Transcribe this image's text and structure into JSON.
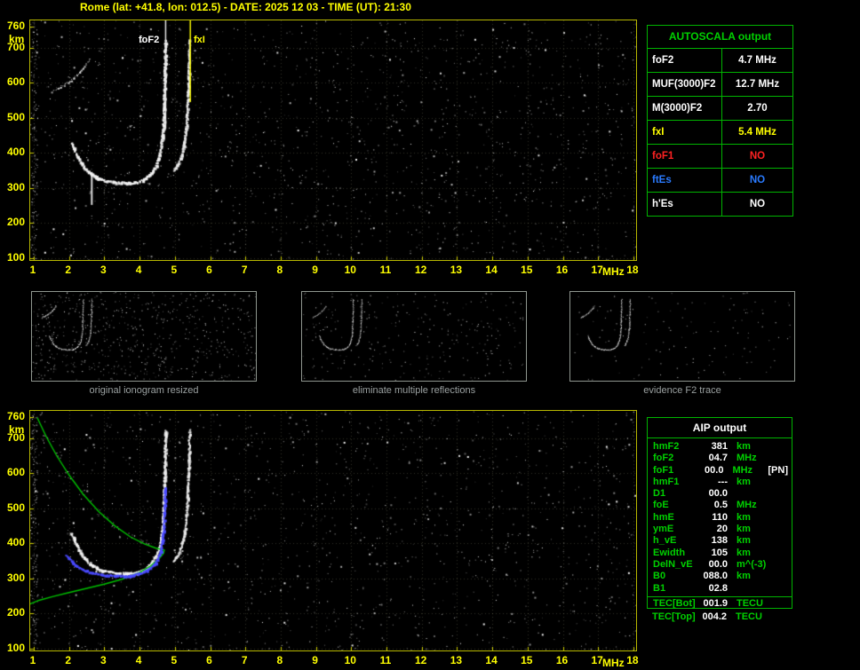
{
  "header": {
    "title": "Rome (lat: +41.8, lon: 012.5) - DATE: 2025 12 03 - TIME (UT): 21:30"
  },
  "axes": {
    "y_unit": "km",
    "x_unit": "MHz",
    "y_ticks": [
      760,
      700,
      600,
      500,
      400,
      300,
      200,
      100
    ],
    "x_ticks": [
      1,
      2,
      3,
      4,
      5,
      6,
      7,
      8,
      9,
      10,
      11,
      12,
      13,
      14,
      15,
      16,
      17,
      18
    ]
  },
  "top_plot": {
    "foF2_label": "foF2",
    "fxI_label": "fxI"
  },
  "autoscala_table": {
    "title": "AUTOSCALA output",
    "rows": [
      {
        "label": "foF2",
        "value": "4.7 MHz",
        "color": "#ffffff"
      },
      {
        "label": "MUF(3000)F2",
        "value": "12.7 MHz",
        "color": "#ffffff"
      },
      {
        "label": "M(3000)F2",
        "value": "2.70",
        "color": "#ffffff"
      },
      {
        "label": "fxI",
        "value": "5.4 MHz",
        "color": "#ffff00"
      },
      {
        "label": "foF1",
        "value": "NO",
        "color": "#ff2222"
      },
      {
        "label": "ftEs",
        "value": "NO",
        "color": "#2a7bff"
      },
      {
        "label": "h'Es",
        "value": "NO",
        "color": "#ffffff"
      }
    ]
  },
  "panels": [
    {
      "caption": "original ionogram resized"
    },
    {
      "caption": "eliminate multiple reflections"
    },
    {
      "caption": "evidence F2 trace"
    }
  ],
  "aip_table": {
    "title": "AIP output",
    "rows": [
      {
        "label": "hmF2",
        "value": "381",
        "unit": "km",
        "extra": ""
      },
      {
        "label": "foF2",
        "value": "04.7",
        "unit": "MHz",
        "extra": ""
      },
      {
        "label": "foF1",
        "value": "00.0",
        "unit": "MHz",
        "extra": "[PN]"
      },
      {
        "label": "hmF1",
        "value": "---",
        "unit": "km",
        "extra": ""
      },
      {
        "label": "D1",
        "value": "00.0",
        "unit": "",
        "extra": ""
      },
      {
        "label": "foE",
        "value": "0.5",
        "unit": "MHz",
        "extra": ""
      },
      {
        "label": "hmE",
        "value": "110",
        "unit": "km",
        "extra": ""
      },
      {
        "label": "ymE",
        "value": "20",
        "unit": "km",
        "extra": ""
      },
      {
        "label": "h_vE",
        "value": "138",
        "unit": "km",
        "extra": ""
      },
      {
        "label": "Ewidth",
        "value": "105",
        "unit": "km",
        "extra": ""
      },
      {
        "label": "DelN_vE",
        "value": "00.0",
        "unit": "m^(-3)",
        "extra": ""
      },
      {
        "label": "B0",
        "value": "088.0",
        "unit": "km",
        "extra": ""
      },
      {
        "label": "B1",
        "value": "02.8",
        "unit": "",
        "extra": ""
      }
    ],
    "tec_rows": [
      {
        "label": "TEC[Bot]",
        "value": "001.9",
        "unit": "TECU"
      },
      {
        "label": "TEC[Top]",
        "value": "004.2",
        "unit": "TECU"
      }
    ]
  },
  "chart_data": {
    "type": "scatter",
    "title": "Ionogram - Rome 2025-12-03 21:30 UT",
    "xlabel": "MHz",
    "ylabel": "km",
    "xlim": [
      1,
      18
    ],
    "ylim": [
      100,
      760
    ],
    "foF2_mhz": 4.7,
    "fxI_mhz": 5.4,
    "MUF3000F2_mhz": 12.7,
    "M3000F2": 2.7,
    "hmF2_km": 381,
    "traces": {
      "f2_ordinary": [
        [
          2.05,
          430
        ],
        [
          2.2,
          395
        ],
        [
          2.4,
          362
        ],
        [
          2.6,
          342
        ],
        [
          2.8,
          330
        ],
        [
          3.0,
          323
        ],
        [
          3.3,
          318
        ],
        [
          3.6,
          316
        ],
        [
          3.9,
          318
        ],
        [
          4.1,
          326
        ],
        [
          4.3,
          342
        ],
        [
          4.45,
          365
        ],
        [
          4.55,
          395
        ],
        [
          4.62,
          435
        ],
        [
          4.66,
          485
        ],
        [
          4.68,
          545
        ],
        [
          4.7,
          625
        ],
        [
          4.72,
          725
        ]
      ],
      "f2_extraordinary": [
        [
          4.95,
          352
        ],
        [
          5.05,
          365
        ],
        [
          5.15,
          388
        ],
        [
          5.24,
          422
        ],
        [
          5.3,
          470
        ],
        [
          5.34,
          535
        ],
        [
          5.37,
          615
        ],
        [
          5.4,
          725
        ]
      ],
      "upper_arc": [
        [
          1.5,
          575
        ],
        [
          1.7,
          585
        ],
        [
          1.9,
          598
        ],
        [
          2.1,
          613
        ],
        [
          2.3,
          632
        ],
        [
          2.45,
          650
        ],
        [
          2.58,
          670
        ]
      ],
      "profile_green": [
        [
          1.1,
          758
        ],
        [
          1.35,
          705
        ],
        [
          1.65,
          650
        ],
        [
          2.0,
          595
        ],
        [
          2.4,
          540
        ],
        [
          2.85,
          490
        ],
        [
          3.3,
          450
        ],
        [
          3.75,
          418
        ],
        [
          4.15,
          398
        ],
        [
          4.45,
          387
        ],
        [
          4.65,
          382
        ],
        [
          4.7,
          381
        ],
        [
          4.68,
          372
        ],
        [
          4.55,
          356
        ],
        [
          4.3,
          335
        ],
        [
          3.95,
          315
        ],
        [
          3.5,
          298
        ],
        [
          3.0,
          284
        ],
        [
          2.5,
          272
        ],
        [
          2.0,
          260
        ],
        [
          1.55,
          249
        ],
        [
          1.15,
          238
        ],
        [
          0.85,
          226
        ],
        [
          0.65,
          212
        ],
        [
          0.52,
          195
        ],
        [
          0.46,
          175
        ],
        [
          0.43,
          150
        ],
        [
          0.42,
          125
        ],
        [
          0.42,
          105
        ]
      ],
      "fitted_blue": [
        [
          1.9,
          368
        ],
        [
          2.1,
          345
        ],
        [
          2.35,
          328
        ],
        [
          2.65,
          317
        ],
        [
          3.0,
          311
        ],
        [
          3.35,
          309
        ],
        [
          3.7,
          310
        ],
        [
          4.0,
          316
        ],
        [
          4.25,
          328
        ],
        [
          4.45,
          348
        ],
        [
          4.58,
          380
        ],
        [
          4.65,
          425
        ],
        [
          4.69,
          490
        ],
        [
          4.71,
          560
        ]
      ]
    }
  }
}
